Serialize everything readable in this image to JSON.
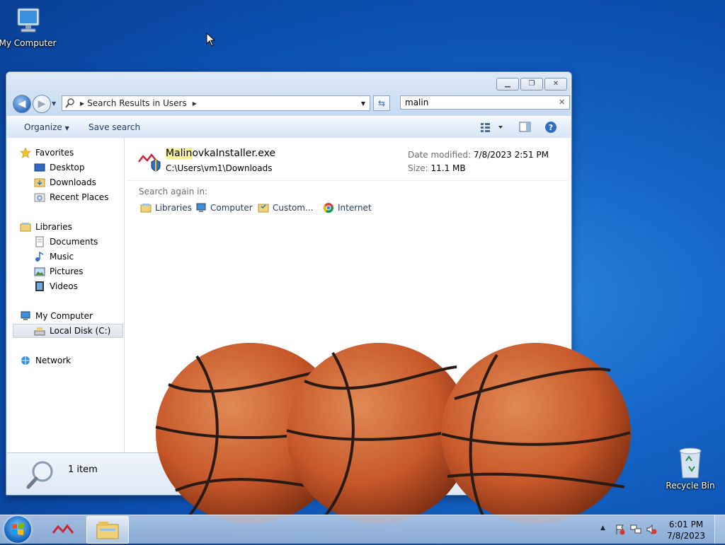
{
  "desktop": {
    "icons": {
      "my_computer": "My Computer",
      "recycle_bin": "Recycle Bin"
    }
  },
  "window": {
    "address": {
      "path_text": "Search Results in Users"
    },
    "search": {
      "value": "malin"
    },
    "toolbar": {
      "organize": "Organize",
      "save_search": "Save search"
    },
    "nav_pane": {
      "favorites": {
        "label": "Favorites",
        "items": [
          "Desktop",
          "Downloads",
          "Recent Places"
        ]
      },
      "libraries": {
        "label": "Libraries",
        "items": [
          "Documents",
          "Music",
          "Pictures",
          "Videos"
        ]
      },
      "computer": {
        "label": "My Computer",
        "items": [
          "Local Disk (C:)"
        ]
      },
      "network": {
        "label": "Network"
      }
    },
    "result": {
      "name_highlight": "Malin",
      "name_rest": "ovkaInstaller.exe",
      "path": "C:\\Users\\vm1\\Downloads",
      "date_label": "Date modified:",
      "date_value": "7/8/2023 2:51 PM",
      "size_label": "Size:",
      "size_value": "11.1 MB"
    },
    "search_again": {
      "label": "Search again in:",
      "items": [
        "Libraries",
        "Computer",
        "Custom...",
        "Internet"
      ]
    },
    "status": {
      "count": "1 item"
    }
  },
  "taskbar": {
    "clock": {
      "time": "6:01 PM",
      "date": "7/8/2023"
    }
  },
  "colors": {
    "desktop_blue": "#1565c6",
    "highlight": "#fbf39b",
    "ball_orange": "#c8582a"
  },
  "icons": [
    "computer-icon",
    "recycle-bin-icon",
    "back-arrow-icon",
    "forward-arrow-icon",
    "search-icon",
    "refresh-icon",
    "star-icon",
    "folder-icon",
    "globe-icon",
    "chrome-icon",
    "magnifier-icon",
    "windows-logo-icon",
    "explorer-icon",
    "malinovka-icon",
    "flag-icon",
    "network-icon",
    "speaker-icon",
    "help-icon"
  ]
}
